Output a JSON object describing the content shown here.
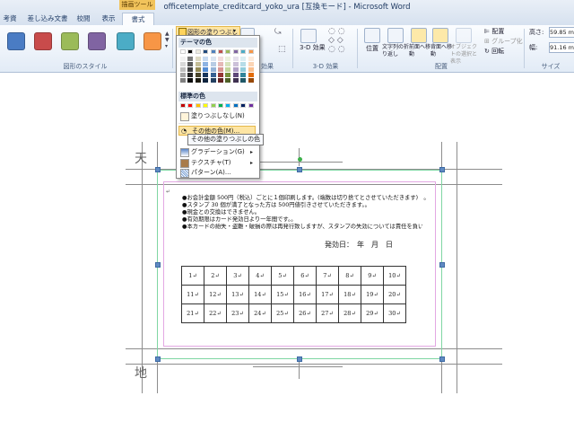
{
  "window": {
    "title": "officetemplate_creditcard_yoko_ura [互換モード] - Microsoft Word",
    "context_tab_group": "描画ツール"
  },
  "tabs": [
    {
      "label": "考資料"
    },
    {
      "label": "差し込み文書"
    },
    {
      "label": "校閲"
    },
    {
      "label": "表示"
    },
    {
      "label": "書式"
    }
  ],
  "ribbon": {
    "shape_styles_label": "図形のスタイル",
    "shape_style_colors": [
      "#4a7cc4",
      "#c84b4b",
      "#9bbb59",
      "#8064a2",
      "#4bacc6",
      "#f79646"
    ],
    "fill_button_label": "図形の塗りつぶし",
    "three_d_label": "3-D 効果",
    "three_d_group_label": "3-D 効果",
    "shadow_group_label": "効果",
    "arrange_group_label": "配置",
    "size_group_label": "サイズ",
    "position_label": "位置",
    "text_wrap_label": "文字列の折り返し",
    "bring_front_label": "前面へ移動",
    "send_back_label": "背面へ移動",
    "selection_pane_label": "オブジェクトの選択と表示",
    "align_label": "配置",
    "group_label": "グループ化",
    "rotate_label": "回転",
    "height_label": "高さ:",
    "height_value": "59.85 m",
    "width_label": "幅:",
    "width_value": "91.16 m"
  },
  "fill_menu": {
    "theme_colors_header": "テーマの色",
    "theme_colors_top": [
      "#ffffff",
      "#000000",
      "#eeece1",
      "#1f497d",
      "#4f81bd",
      "#c0504d",
      "#9bbb59",
      "#8064a2",
      "#4bacc6",
      "#f79646"
    ],
    "theme_shade_columns": [
      [
        "#f2f2f2",
        "#d9d9d9",
        "#bfbfbf",
        "#a6a6a6",
        "#808080"
      ],
      [
        "#7f7f7f",
        "#595959",
        "#404040",
        "#262626",
        "#0d0d0d"
      ],
      [
        "#ddd9c3",
        "#c4bd97",
        "#948a54",
        "#4a452a",
        "#1d1b10"
      ],
      [
        "#c6d9f0",
        "#8db3e2",
        "#548dd4",
        "#17365d",
        "#0f243e"
      ],
      [
        "#dbe5f1",
        "#b8cce4",
        "#95b3d7",
        "#366092",
        "#244061"
      ],
      [
        "#f2dcdb",
        "#e5b9b7",
        "#d99694",
        "#953734",
        "#632423"
      ],
      [
        "#ebf1dd",
        "#d7e3bc",
        "#c3d69b",
        "#76923c",
        "#4f6128"
      ],
      [
        "#e5e0ec",
        "#ccc1d9",
        "#b2a2c7",
        "#5f497a",
        "#3f3151"
      ],
      [
        "#dbeef3",
        "#b7dde8",
        "#92cddc",
        "#31859b",
        "#205867"
      ],
      [
        "#fdeada",
        "#fbd5b5",
        "#fac08f",
        "#e36c09",
        "#974806"
      ]
    ],
    "standard_colors_header": "標準の色",
    "standard_colors": [
      "#c00000",
      "#ff0000",
      "#ffc000",
      "#ffff00",
      "#92d050",
      "#00b050",
      "#00b0f0",
      "#0070c0",
      "#002060",
      "#7030a0"
    ],
    "no_fill": "塗りつぶしなし(N)",
    "more_colors": "その他の色(M)...",
    "gradient": "グラデーション(G)",
    "texture": "テクスチャ(T)",
    "pattern": "パターン(A)...",
    "tooltip": "その他の塗りつぶしの色"
  },
  "document": {
    "top_label": "天",
    "bottom_label": "地",
    "bullets": [
      "●お会計金額 500円（税込）ごとに１個印刷します。(端数は切り捨てとさせていただきます)　。",
      "●スタンプ 30 個が満了となった方は 500円値引きさせていただきます。。",
      "●現金との交換はできません。",
      "●有効期限はカード発効日より一年間です。。",
      "●本カードの紛失・盗難・破損の際は再発行致しますが、スタンプの失効については責任を負いかねます。。"
    ],
    "issue_date": "発効日：　年　月　日",
    "stamp_rows": [
      [
        "1↵",
        "2↵",
        "3↵",
        "4↵",
        "5↵",
        "6↵",
        "7↵",
        "8↵",
        "9↵",
        "10↵"
      ],
      [
        "11↵",
        "12↵",
        "13↵",
        "14↵",
        "15↵",
        "16↵",
        "17↵",
        "18↵",
        "19↵",
        "20↵"
      ],
      [
        "21↵",
        "22↵",
        "23↵",
        "24↵",
        "25↵",
        "26↵",
        "27↵",
        "28↵",
        "29↵",
        "30↵"
      ]
    ]
  }
}
